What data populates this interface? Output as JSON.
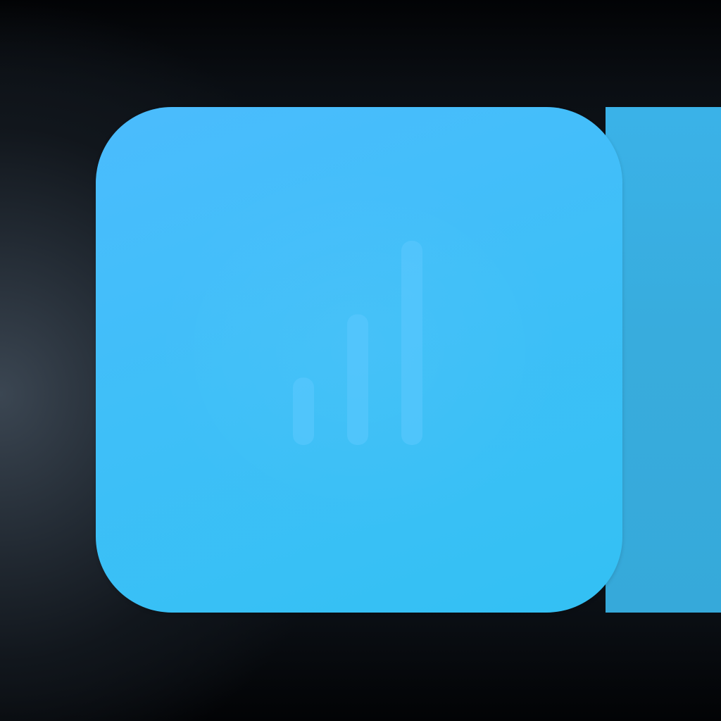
{
  "icon": {
    "name": "bar-chart-icon",
    "levels": [
      0.33,
      0.64,
      1.0
    ]
  },
  "colors": {
    "tile_top": "#4bbcfd",
    "tile_bottom": "#33c0f3",
    "side_band": "#38acdd",
    "background_dark": "#05070a",
    "background_mid": "#232b34",
    "bar": "#5cc8ff"
  }
}
